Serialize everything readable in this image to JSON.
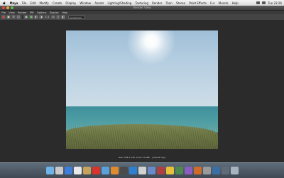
{
  "mac_menu": {
    "app": "Maya",
    "items": [
      "File",
      "Edit",
      "Modify",
      "Create",
      "Display",
      "Window",
      "Assets",
      "Lighting/Shading",
      "Texturing",
      "Render",
      "Toon",
      "Stereo",
      "Paint Effects",
      "Fur",
      "Muscle",
      "Help"
    ],
    "clock": "Tue 23:26"
  },
  "window": {
    "title": "Render View"
  },
  "view_menu": {
    "items": [
      "File",
      "View",
      "Render",
      "IPR",
      "Options",
      "Display",
      "Help"
    ]
  },
  "toolbar": {
    "camera_select": "renderCam",
    "ratio": "1:1"
  },
  "render_info": {
    "line1": "size: 768 x 576  zoom: 0.288    (mental ray)",
    "line2": "Frame: 1     Render Time: 0:03     Camera: persp"
  }
}
